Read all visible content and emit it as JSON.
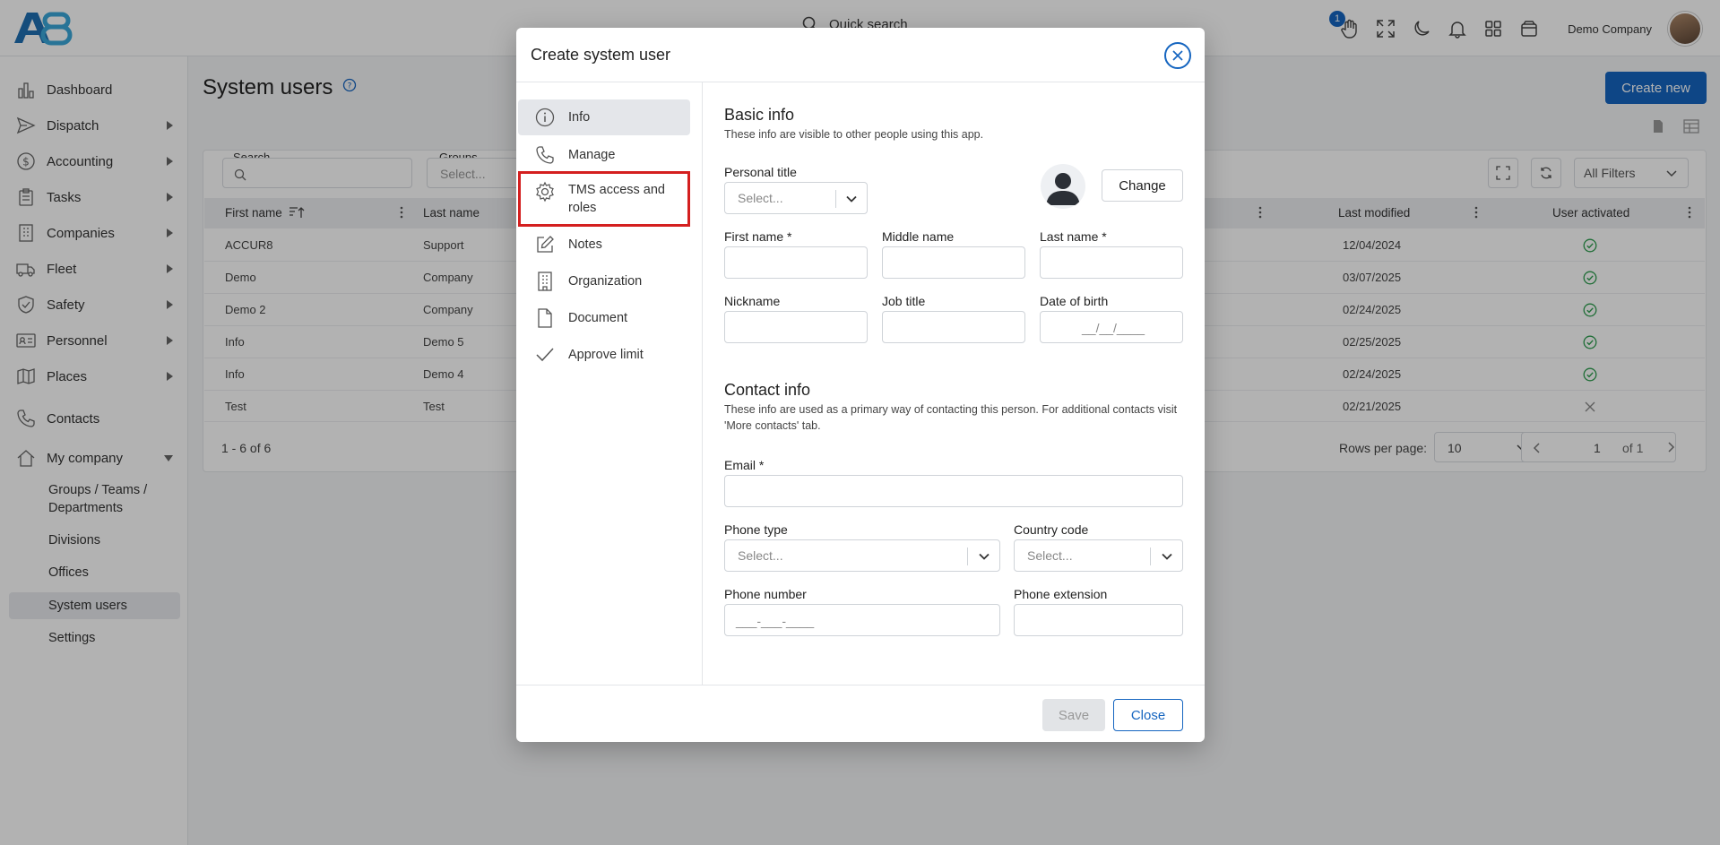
{
  "topbar": {
    "logo_text": "A8",
    "quick_search_placeholder": "Quick search",
    "notification_count": "1",
    "company_name": "Demo Company"
  },
  "sidebar": {
    "items": [
      {
        "label": "Dashboard",
        "icon": "chart-bar-icon"
      },
      {
        "label": "Dispatch",
        "icon": "send-icon"
      },
      {
        "label": "Accounting",
        "icon": "dollar-icon"
      },
      {
        "label": "Tasks",
        "icon": "clipboard-icon"
      },
      {
        "label": "Companies",
        "icon": "building-icon"
      },
      {
        "label": "Fleet",
        "icon": "truck-icon"
      },
      {
        "label": "Safety",
        "icon": "shield-icon"
      },
      {
        "label": "Personnel",
        "icon": "id-card-icon"
      },
      {
        "label": "Places",
        "icon": "map-icon"
      },
      {
        "label": "Contacts",
        "icon": "phone-icon"
      },
      {
        "label": "My company",
        "icon": "home-icon"
      }
    ],
    "sub_items": [
      "Groups / Teams / Departments",
      "Divisions",
      "Offices",
      "System users",
      "Settings"
    ]
  },
  "page": {
    "title": "System users",
    "create_new_label": "Create new",
    "filters": {
      "search_label": "Search",
      "groups_label": "Groups",
      "groups_placeholder": "Select...",
      "all_filters_label": "All Filters"
    },
    "table": {
      "columns": [
        "First name",
        "Last name",
        "Last modified",
        "User activated"
      ],
      "rows": [
        {
          "first": "ACCUR8",
          "last": "Support",
          "modified": "12/04/2024",
          "active": true
        },
        {
          "first": "Demo",
          "last": "Company",
          "modified": "03/07/2025",
          "active": true
        },
        {
          "first": "Demo 2",
          "last": "Company",
          "modified": "02/24/2025",
          "active": true
        },
        {
          "first": "Info",
          "last": "Demo 5",
          "modified": "02/25/2025",
          "active": true
        },
        {
          "first": "Info",
          "last": "Demo 4",
          "modified": "02/24/2025",
          "active": true
        },
        {
          "first": "Test",
          "last": "Test",
          "modified": "02/21/2025",
          "active": false
        }
      ]
    },
    "pagination": {
      "range": "1 - 6 of 6",
      "rows_per_page_label": "Rows per page:",
      "rows_per_page": "10",
      "page": "1",
      "of_pages": "of 1"
    }
  },
  "modal": {
    "title": "Create system user",
    "nav": [
      {
        "label": "Info",
        "icon": "info-icon"
      },
      {
        "label": "Manage",
        "icon": "phone-icon"
      },
      {
        "label": "TMS access and roles",
        "icon": "gear-icon"
      },
      {
        "label": "Notes",
        "icon": "edit-icon"
      },
      {
        "label": "Organization",
        "icon": "building-icon"
      },
      {
        "label": "Document",
        "icon": "file-icon"
      },
      {
        "label": "Approve limit",
        "icon": "check-icon"
      }
    ],
    "basic": {
      "title": "Basic info",
      "desc": "These info are visible to other people using this app.",
      "personal_title_label": "Personal title",
      "personal_title_placeholder": "Select...",
      "change_label": "Change",
      "first_name_label": "First name *",
      "middle_name_label": "Middle name",
      "last_name_label": "Last name *",
      "nickname_label": "Nickname",
      "job_title_label": "Job title",
      "dob_label": "Date of birth",
      "dob_placeholder": "__/__/____"
    },
    "contact": {
      "title": "Contact info",
      "desc": "These info are used as a primary way of contacting this person. For additional contacts visit 'More contacts' tab.",
      "email_label": "Email *",
      "phone_type_label": "Phone type",
      "phone_type_placeholder": "Select...",
      "country_code_label": "Country code",
      "country_code_placeholder": "Select...",
      "phone_number_label": "Phone number",
      "phone_number_placeholder": "___-___-____",
      "phone_ext_label": "Phone extension"
    },
    "save_label": "Save",
    "close_label": "Close"
  },
  "colors": {
    "accent": "#1565c0",
    "highlight": "#d41f1f",
    "success": "#2e9e4f"
  }
}
